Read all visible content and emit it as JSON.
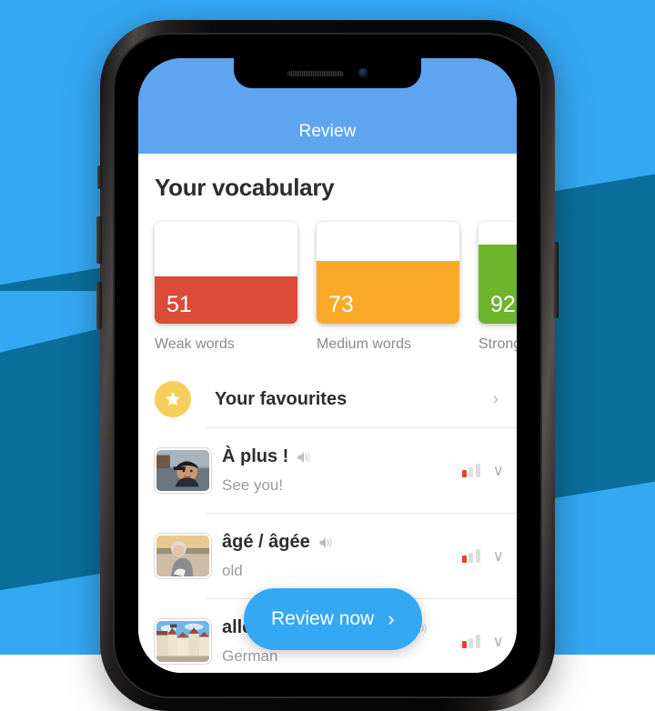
{
  "background": {
    "base_color": "#35A8F4",
    "wedge_color": "#0a6f9b"
  },
  "device": {
    "notch": {
      "speaker_icon": "speaker-grille",
      "camera_icon": "front-camera-icon"
    },
    "buttons": [
      "mute-switch",
      "volume-up",
      "volume-down",
      "power"
    ]
  },
  "app": {
    "header": {
      "title": "Review",
      "background": "#5EA5F0"
    },
    "page_title": "Your vocabulary",
    "stats": [
      {
        "value": "51",
        "label": "Weak words",
        "color": "#DC4B37",
        "fill_percent": 46
      },
      {
        "value": "73",
        "label": "Medium words",
        "color": "#FAAA28",
        "fill_percent": 62
      },
      {
        "value": "92",
        "label": "Strong words",
        "color": "#6CB52D",
        "fill_percent": 78
      }
    ],
    "favourites": {
      "label": "Your favourites",
      "icon": "star-icon",
      "chevron": "›",
      "circle_color": "#F5CE5B"
    },
    "vocabulary": [
      {
        "term": "À plus !",
        "definition": "See you!",
        "audio_icon": "speaker-icon",
        "strength": 1,
        "strength_color": "#E8402A",
        "chevron": "∨",
        "thumb": "man-in-cap-smiling"
      },
      {
        "term": "âgé / âgée",
        "definition": "old",
        "audio_icon": "speaker-icon",
        "strength": 1,
        "strength_color": "#E8402A",
        "chevron": "∨",
        "thumb": "elderly-woman-at-beach"
      },
      {
        "term": "allemand / allemande",
        "definition": "German",
        "audio_icon": "speaker-icon",
        "strength": 1,
        "strength_color": "#E8402A",
        "chevron": "∨",
        "thumb": "german-town-houses"
      }
    ],
    "fab": {
      "label": "Review now",
      "chevron": "›",
      "color": "#35A8F4"
    }
  }
}
